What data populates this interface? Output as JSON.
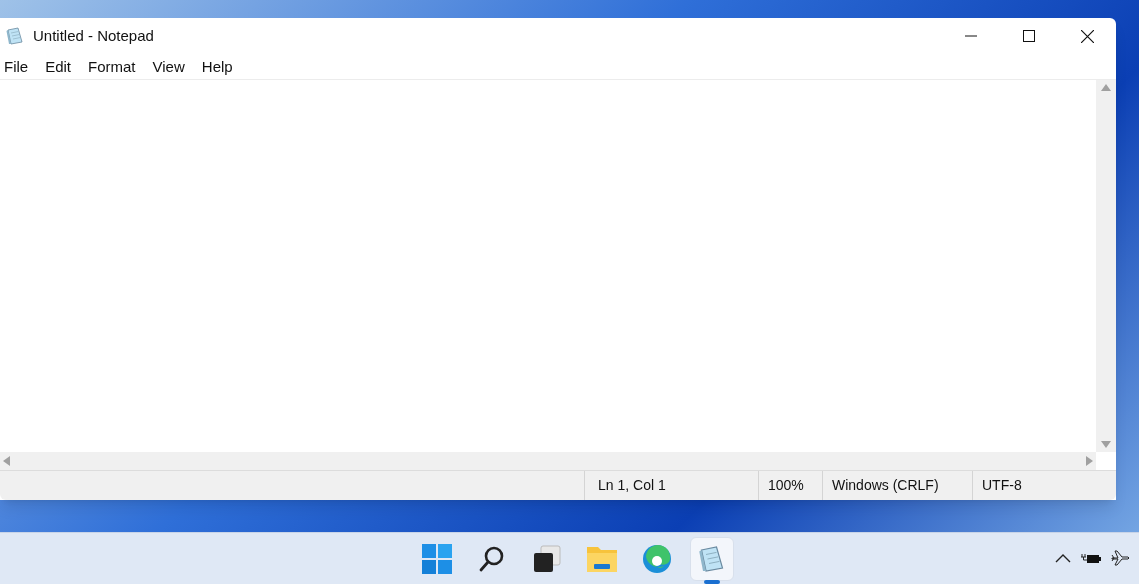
{
  "window": {
    "title": "Untitled - Notepad"
  },
  "menu": [
    "File",
    "Edit",
    "Format",
    "View",
    "Help"
  ],
  "status_bar": [
    "Ln 1, Col 1",
    "100%",
    "Windows (CRLF)",
    "UTF-8"
  ],
  "taskbar": [
    {
      "kind": "start",
      "selected": false
    },
    {
      "kind": "search",
      "selected": false
    },
    {
      "kind": "taskview",
      "selected": false
    },
    {
      "kind": "explorer",
      "selected": false
    },
    {
      "kind": "browser",
      "selected": false
    },
    {
      "kind": "notepad",
      "selected": true
    }
  ]
}
